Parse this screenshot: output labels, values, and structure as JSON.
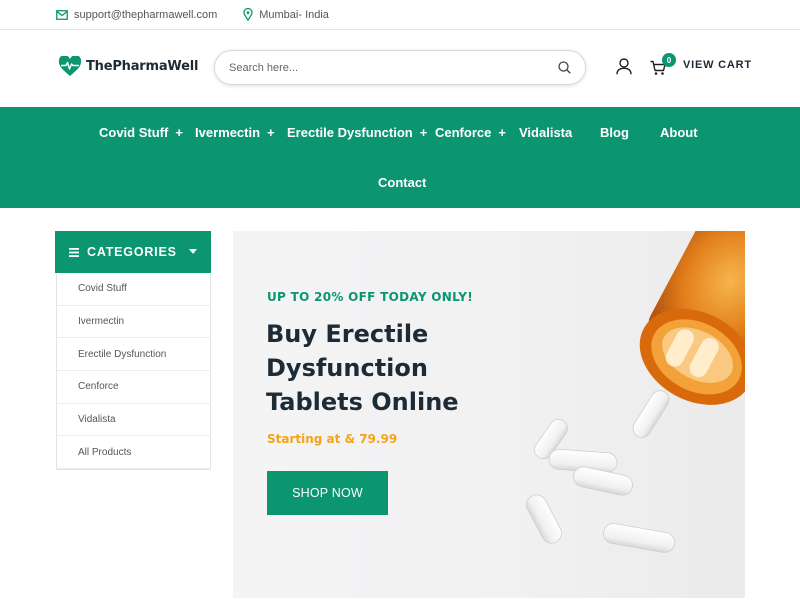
{
  "topbar": {
    "email": "support@thepharmawell.com",
    "location": "Mumbai- India",
    "icons": [
      "mail-icon",
      "location-pin-icon"
    ]
  },
  "header": {
    "logo_text": "ThePharmaWell",
    "search_placeholder": "Search here...",
    "cart_count": "0",
    "cart_label": "VIEW CART",
    "icons": [
      "heart-pulse-logo-icon",
      "search-icon",
      "user-icon",
      "cart-icon"
    ]
  },
  "nav": {
    "items": [
      {
        "label": "Covid Stuff",
        "has_submenu": "+"
      },
      {
        "label": "Ivermectin",
        "has_submenu": "+"
      },
      {
        "label": "Erectile Dysfunction",
        "has_submenu": "+"
      },
      {
        "label": "Cenforce",
        "has_submenu": "+"
      },
      {
        "label": "Vidalista",
        "has_submenu": ""
      },
      {
        "label": "Blog",
        "has_submenu": ""
      },
      {
        "label": "About",
        "has_submenu": ""
      },
      {
        "label": "Contact",
        "has_submenu": ""
      }
    ]
  },
  "categories": {
    "title": "CATEGORIES",
    "items": [
      "Covid Stuff",
      "Ivermectin",
      "Erectile Dysfunction",
      "Cenforce",
      "Vidalista",
      "All Products"
    ]
  },
  "banner": {
    "promo": "UP TO 20% OFF TODAY ONLY!",
    "headline_line1": "Buy Erectile",
    "headline_line2": "Dysfunction",
    "headline_line3": "Tablets Online",
    "price": "Starting at & 79.99",
    "button": "SHOP NOW"
  },
  "colors": {
    "brand_green": "#0b9570",
    "price_orange": "#f5a31a",
    "text_dark": "#1d2b36"
  }
}
